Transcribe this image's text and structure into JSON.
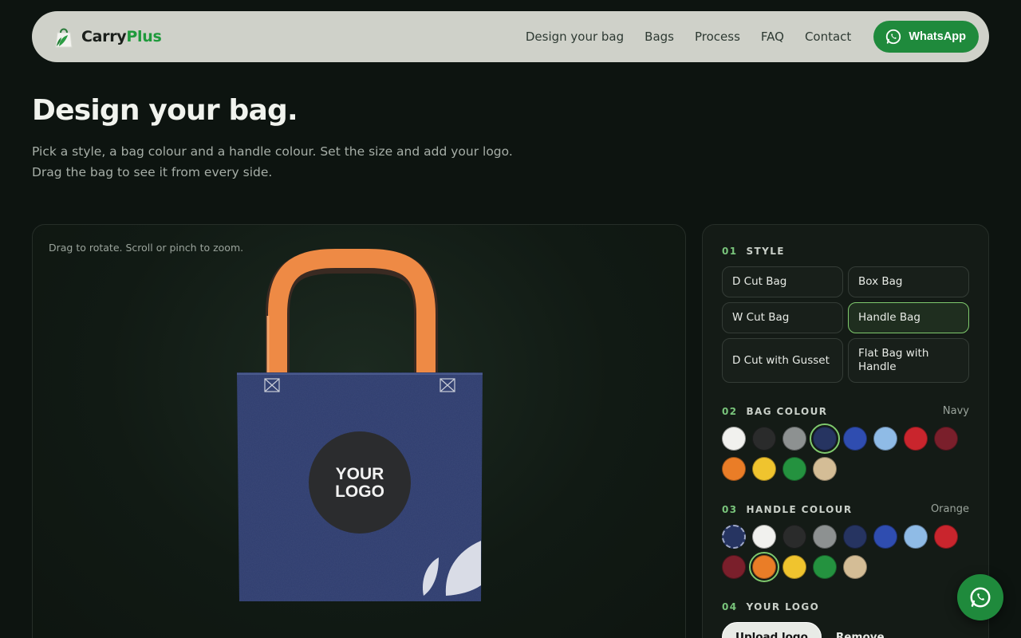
{
  "brand": {
    "name_a": "Carry",
    "name_b": "Plus"
  },
  "nav": {
    "links": [
      "Design your bag",
      "Bags",
      "Process",
      "FAQ",
      "Contact"
    ],
    "whatsapp_label": "WhatsApp"
  },
  "hero": {
    "title": "Design your bag.",
    "subtitle": "Pick a style, a bag colour and a handle colour. Set the size and add your logo. Drag the bag to see it from every side."
  },
  "viewer": {
    "hint": "Drag to rotate. Scroll or pinch to zoom.",
    "logo_line1": "YOUR",
    "logo_line2": "LOGO",
    "bag_color": "#2f3d6e",
    "handle_color": "#ee8a45"
  },
  "panel": {
    "style": {
      "num": "01",
      "label": "STYLE",
      "options": [
        "D Cut Bag",
        "Box Bag",
        "W Cut Bag",
        "Handle Bag",
        "D Cut with Gusset",
        "Flat Bag with Handle"
      ],
      "selected": "Handle Bag"
    },
    "bag_colour": {
      "num": "02",
      "label": "BAG COLOUR",
      "value": "Navy",
      "colors": [
        "#f1f1ee",
        "#2a2b2b",
        "#8d9191",
        "#263461",
        "#2f4db0",
        "#8fbbe6",
        "#c9252d",
        "#7a1f2b",
        "#ea7d27",
        "#f0c42e",
        "#24923f",
        "#d4bd96"
      ],
      "selected_index": 3
    },
    "handle_colour": {
      "num": "03",
      "label": "HANDLE COLOUR",
      "value": "Orange",
      "colors": [
        "none",
        "#f1f1ee",
        "#2a2b2b",
        "#8d9191",
        "#263461",
        "#2f4db0",
        "#8fbbe6",
        "#c9252d",
        "#7a1f2b",
        "#ea7d27",
        "#f0c42e",
        "#24923f",
        "#d4bd96"
      ],
      "selected_index": 9
    },
    "logo": {
      "num": "04",
      "label": "YOUR LOGO",
      "upload_label": "Upload logo",
      "remove_label": "Remove"
    }
  }
}
